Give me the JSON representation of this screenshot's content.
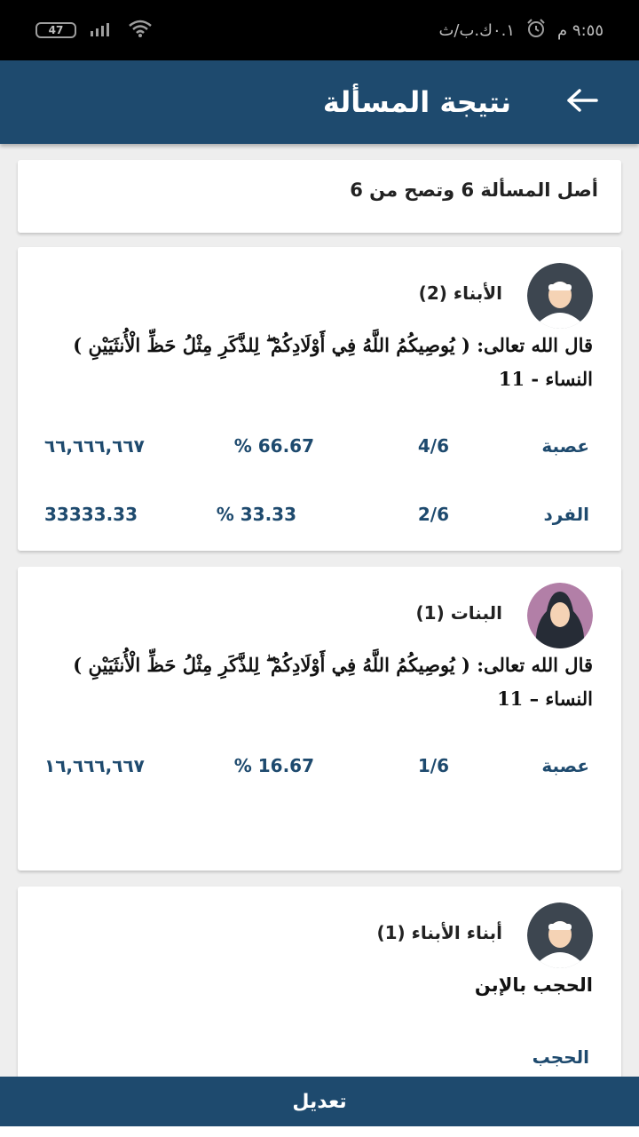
{
  "status_bar": {
    "battery": "47",
    "time": "٩:٥٥ م",
    "speed": "٠.١ك.ب/ث"
  },
  "header": {
    "title": "نتيجة المسألة",
    "back_icon": "arrow-back-icon"
  },
  "origin_text": "أصل المسألة 6 وتصح من 6",
  "heirs": [
    {
      "name": "الأبناء (2)",
      "avatar": "male-avatar-icon",
      "quote": "قال الله تعالى: ( يُوصِيكُمُ اللَّهُ فِي أَوْلَادِكُمْ ۖ لِلذَّكَرِ مِثْلُ حَظِّ الْأُنثَيَيْنِ ) النساء - 11",
      "shares": [
        {
          "type": "عصبة",
          "fraction": "4/6",
          "percent": "% 66.67",
          "amount": "٦٦,٦٦٦,٦٦٧"
        },
        {
          "type": "الفرد",
          "fraction": "2/6",
          "percent": "% 33.33",
          "amount": "33333.33"
        }
      ]
    },
    {
      "name": "البنات (1)",
      "avatar": "female-avatar-icon",
      "quote": "قال الله تعالى: ( يُوصِيكُمُ اللَّهُ فِي أَوْلَادِكُمْ ۖ لِلذَّكَرِ مِثْلُ حَظِّ الْأُنثَيَيْنِ ) النساء – 11",
      "shares": [
        {
          "type": "عصبة",
          "fraction": "1/6",
          "percent": "% 16.67",
          "amount": "١٦,٦٦٦,٦٦٧"
        }
      ]
    },
    {
      "name": "أبناء الأبناء (1)",
      "avatar": "male-avatar-icon",
      "note": "الحجب بالإبن",
      "status": "الحجب"
    }
  ],
  "bottom_button": "تعديل",
  "colors": {
    "primary": "#1e4a6e",
    "background": "#eeeeee",
    "female_avatar_bg": "#b27fa7",
    "male_avatar_bg": "#3d4650"
  }
}
